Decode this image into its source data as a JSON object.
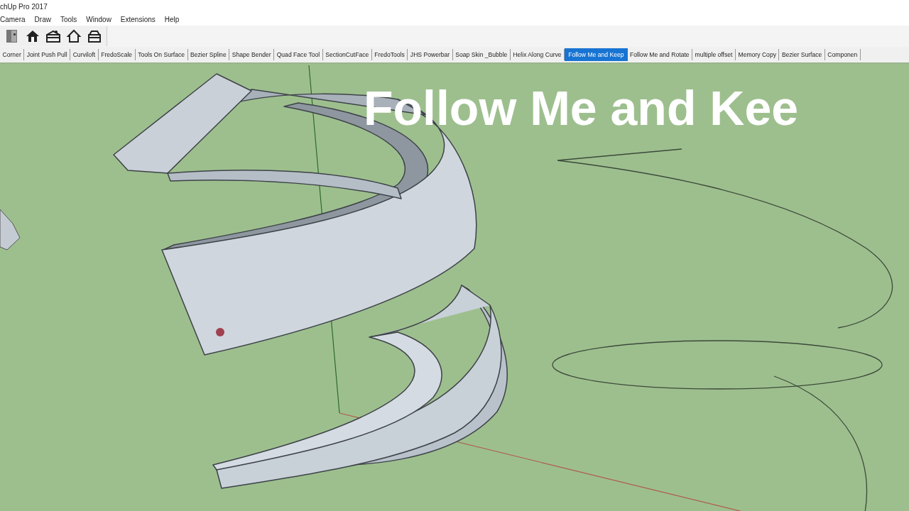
{
  "window": {
    "title": "chUp Pro 2017"
  },
  "menu": [
    {
      "label": "Camera"
    },
    {
      "label": "Draw"
    },
    {
      "label": "Tools"
    },
    {
      "label": "Window"
    },
    {
      "label": "Extensions"
    },
    {
      "label": "Help"
    }
  ],
  "extension_tabs": [
    {
      "label": "Corner",
      "selected": false
    },
    {
      "label": "Joint Push Pull",
      "selected": false
    },
    {
      "label": "Curviloft",
      "selected": false
    },
    {
      "label": "FredoScale",
      "selected": false
    },
    {
      "label": "Tools On Surface",
      "selected": false
    },
    {
      "label": "Bezier Spline",
      "selected": false
    },
    {
      "label": "Shape Bender",
      "selected": false
    },
    {
      "label": "Quad Face Tool",
      "selected": false
    },
    {
      "label": "SectionCutFace",
      "selected": false
    },
    {
      "label": "FredoTools",
      "selected": false
    },
    {
      "label": "JHS Powerbar",
      "selected": false
    },
    {
      "label": "Soap Skin _Bubble",
      "selected": false
    },
    {
      "label": "Helix Along Curve",
      "selected": false
    },
    {
      "label": "Follow Me and Keep",
      "selected": true
    },
    {
      "label": "Follow Me and Rotate",
      "selected": false
    },
    {
      "label": "multiple offset",
      "selected": false
    },
    {
      "label": "Memory Copy",
      "selected": false
    },
    {
      "label": "Bezier Surface",
      "selected": false
    },
    {
      "label": "Componen",
      "selected": false
    }
  ],
  "viewport": {
    "caption": "Follow Me and Kee"
  }
}
